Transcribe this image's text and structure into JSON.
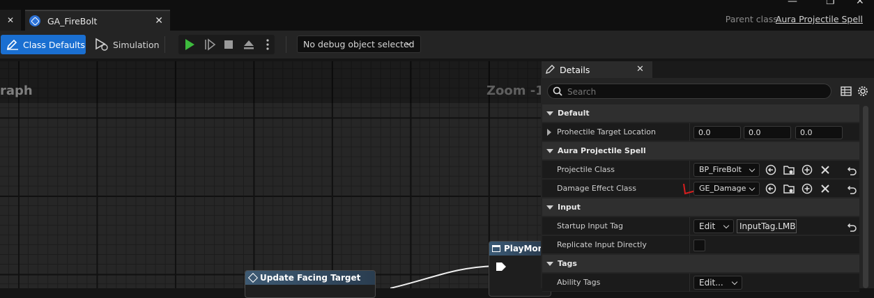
{
  "window": {
    "tab_title": "GA_FireBolt",
    "parent_class_label": "Parent class:",
    "parent_class_value": "Aura Projectile Spell"
  },
  "toolbar": {
    "class_defaults_label": "Class Defaults",
    "simulation_label": "Simulation",
    "debug_select": "No debug object selected"
  },
  "graph": {
    "title": "raph",
    "zoom": "Zoom -1",
    "nodes": [
      {
        "title": "Update Facing Target"
      },
      {
        "title": "PlayMon"
      }
    ]
  },
  "details": {
    "tab_label": "Details",
    "search_placeholder": "Search",
    "categories": [
      {
        "name": "Default",
        "rows": [
          {
            "label": "Prohectile Target Location",
            "values": [
              "0.0",
              "0.0",
              "0.0"
            ]
          }
        ]
      },
      {
        "name": "Aura Projectile Spell",
        "rows": [
          {
            "label": "Projectile Class",
            "value": "BP_FireBolt"
          },
          {
            "label": "Damage Effect Class",
            "value": "GE_Damage"
          }
        ]
      },
      {
        "name": "Input",
        "rows": [
          {
            "label": "Startup Input Tag",
            "edit": "Edit",
            "value": "InputTag.LMB"
          },
          {
            "label": "Replicate Input Directly",
            "checked": false
          }
        ]
      },
      {
        "name": "Tags",
        "rows": [
          {
            "label": "Ability Tags",
            "edit": "Edit..."
          }
        ]
      }
    ]
  },
  "colors": {
    "accent": "#1a6fd1",
    "play_green": "#3dbb3d",
    "annotation_red": "#d81e1e"
  }
}
